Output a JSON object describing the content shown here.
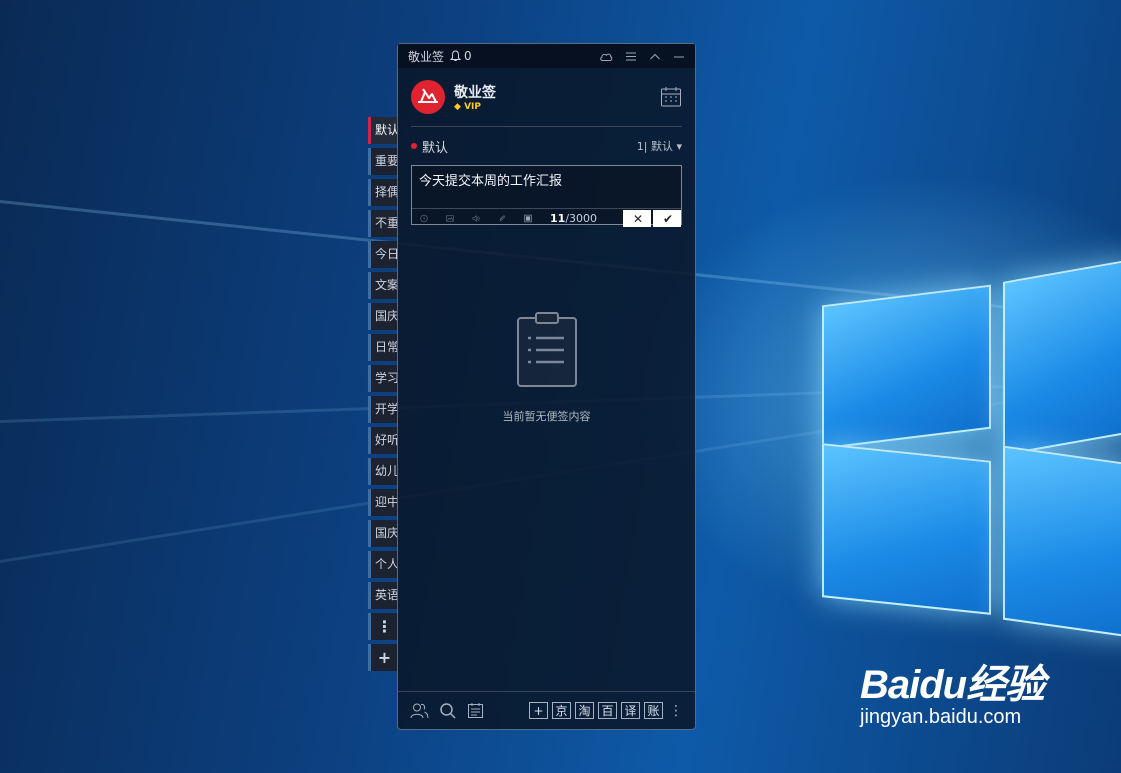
{
  "app": {
    "title": "敬业签",
    "notification_count": "0"
  },
  "profile": {
    "name": "敬业签",
    "badge": "VIP"
  },
  "category": {
    "current": "默认",
    "sort_label": "1| 默认"
  },
  "editor": {
    "text": "今天提交本周的工作汇报",
    "count": "11",
    "limit": "/3000"
  },
  "empty_state": {
    "message": "当前暂无便签内容"
  },
  "side_tabs": [
    {
      "label": "默认",
      "active": true
    },
    {
      "label": "重要"
    },
    {
      "label": "择偶"
    },
    {
      "label": "不重"
    },
    {
      "label": "今日"
    },
    {
      "label": "文案"
    },
    {
      "label": "国庆"
    },
    {
      "label": "日常"
    },
    {
      "label": "学习"
    },
    {
      "label": "开学"
    },
    {
      "label": "好听"
    },
    {
      "label": "幼儿"
    },
    {
      "label": "迎中"
    },
    {
      "label": "国庆"
    },
    {
      "label": "个人"
    },
    {
      "label": "英语"
    }
  ],
  "side_more": "⋮",
  "side_add": "+",
  "footer_shortcuts": [
    "+",
    "京",
    "淘",
    "百",
    "译",
    "账"
  ],
  "watermark": {
    "main": "Baidu经验",
    "sub": "jingyan.baidu.com"
  },
  "colors": {
    "accent": "#e0242f",
    "vip": "#ffcc22"
  }
}
